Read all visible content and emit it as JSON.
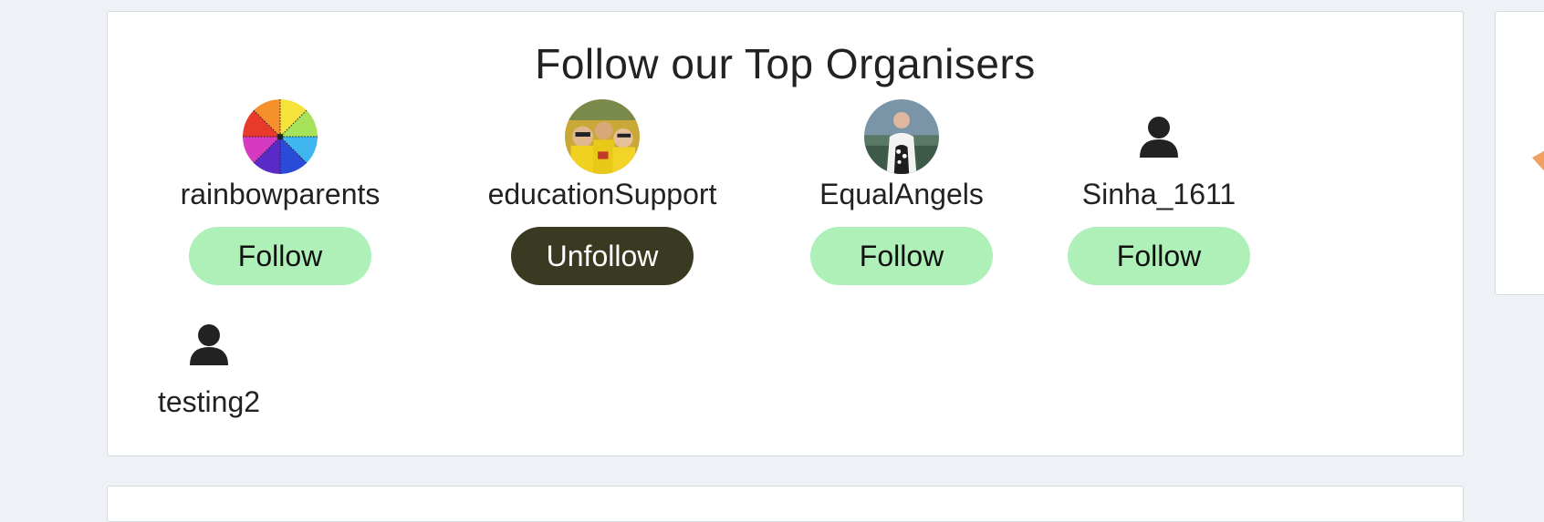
{
  "section": {
    "title": "Follow our Top Organisers"
  },
  "organisers": [
    {
      "username": "rainbowparents",
      "button_label": "Follow",
      "avatar": "rainbow-wheel-avatar"
    },
    {
      "username": "educationSupport",
      "button_label": "Unfollow",
      "avatar": "group-photo-avatar"
    },
    {
      "username": "EqualAngels",
      "button_label": "Follow",
      "avatar": "person-photo-avatar"
    },
    {
      "username": "Sinha_1611",
      "button_label": "Follow",
      "avatar": "person-icon"
    },
    {
      "username": "testing2",
      "button_label": "",
      "avatar": "person-icon"
    }
  ],
  "colors": {
    "follow_button": "#aef0b8",
    "unfollow_button": "#3a3a22",
    "background": "#eef2f6",
    "accent_orange": "#f0a060"
  }
}
